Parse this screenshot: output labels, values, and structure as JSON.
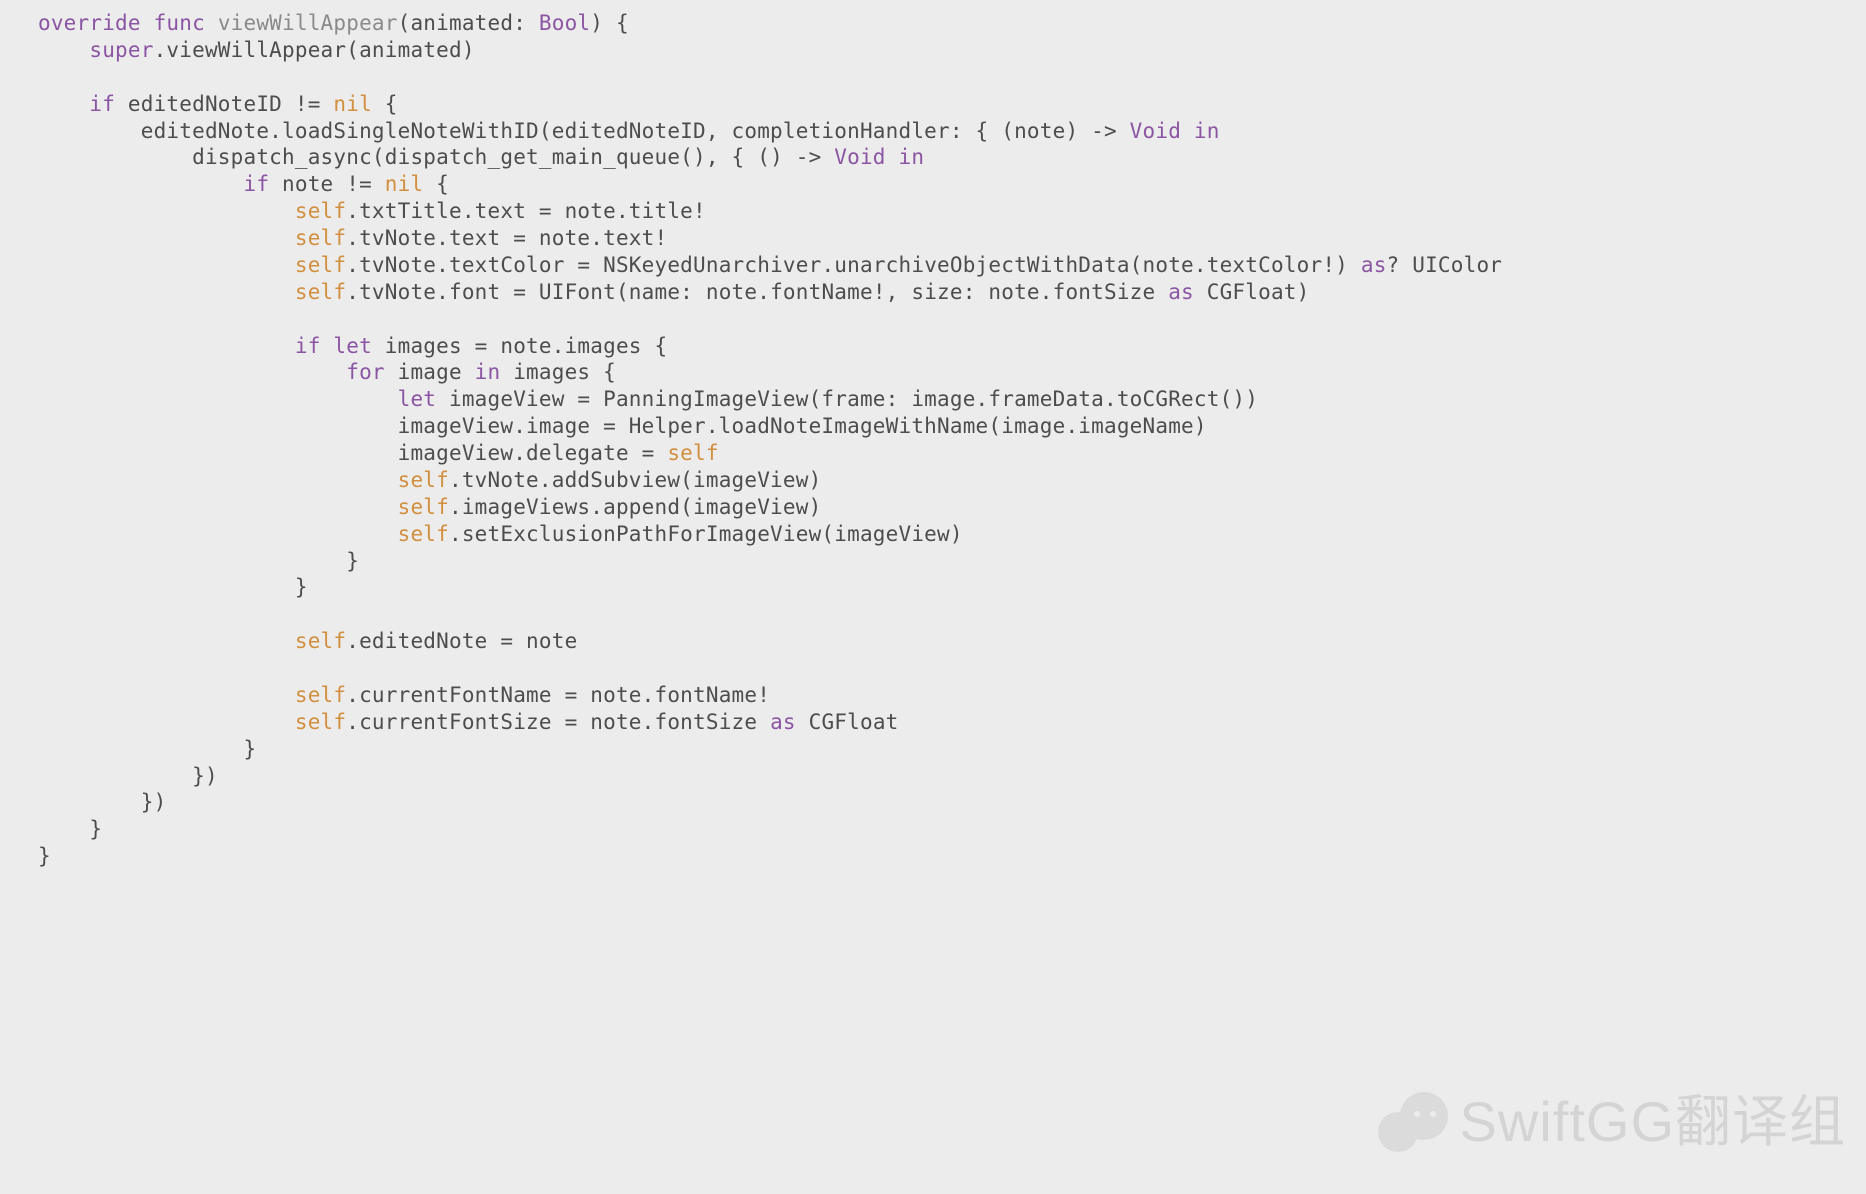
{
  "watermark": {
    "text": "SwiftGG翻译组"
  },
  "code": {
    "t01a": "override",
    "t01b": " ",
    "t01c": "func",
    "t01d": " ",
    "t01e": "viewWillAppear",
    "t01f": "(animated: ",
    "t01g": "Bool",
    "t01h": ") {",
    "t02a": "super",
    "t02b": ".viewWillAppear(animated)",
    "t03a": "if",
    "t03b": " editedNoteID != ",
    "t03c": "nil",
    "t03d": " {",
    "t04a": "editedNote.loadSingleNoteWithID(editedNoteID, completionHandler: { (note) -> ",
    "t04b": "Void",
    "t04c": " ",
    "t04d": "in",
    "t05a": "dispatch_async(dispatch_get_main_queue(), { () -> ",
    "t05b": "Void",
    "t05c": " ",
    "t05d": "in",
    "t06a": "if",
    "t06b": " note != ",
    "t06c": "nil",
    "t06d": " {",
    "t07a": "self",
    "t07b": ".txtTitle.text = note.title!",
    "t08a": "self",
    "t08b": ".tvNote.text = note.text!",
    "t09a": "self",
    "t09b": ".tvNote.textColor = NSKeyedUnarchiver.unarchiveObjectWithData(note.textColor!) ",
    "t09c": "as",
    "t09d": "? UIColor",
    "t10a": "self",
    "t10b": ".tvNote.font = UIFont(name: note.fontName!, size: note.fontSize ",
    "t10c": "as",
    "t10d": " CGFloat)",
    "t11a": "if",
    "t11b": " ",
    "t11c": "let",
    "t11d": " images = note.images {",
    "t12a": "for",
    "t12b": " image ",
    "t12c": "in",
    "t12d": " images {",
    "t13a": "let",
    "t13b": " imageView = PanningImageView(frame: image.frameData.toCGRect())",
    "t14": "imageView.image = Helper.loadNoteImageWithName(image.imageName)",
    "t15a": "imageView.delegate = ",
    "t15b": "self",
    "t16a": "self",
    "t16b": ".tvNote.addSubview(imageView)",
    "t17a": "self",
    "t17b": ".imageViews.append(imageView)",
    "t18a": "self",
    "t18b": ".setExclusionPathForImageView(imageView)",
    "t19": "}",
    "t20": "}",
    "t21a": "self",
    "t21b": ".editedNote = note",
    "t22a": "self",
    "t22b": ".currentFontName = note.fontName!",
    "t23a": "self",
    "t23b": ".currentFontSize = note.fontSize ",
    "t23c": "as",
    "t23d": " CGFloat",
    "t24": "}",
    "t25": "})",
    "t26": "})",
    "t27": "}",
    "t28": "}"
  }
}
